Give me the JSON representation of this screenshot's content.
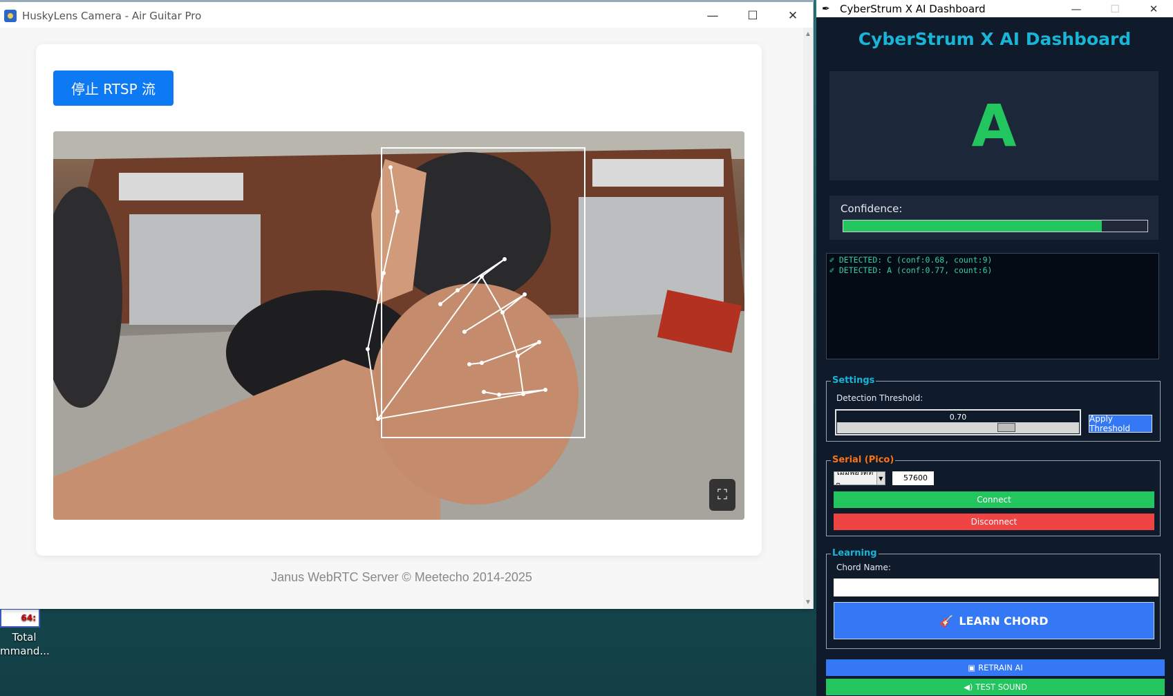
{
  "desktop": {
    "icon_badge": "64:",
    "icon_label_1": "Total",
    "icon_label_2": "mmand..."
  },
  "left_window": {
    "title": "HuskyLens Camera - Air Guitar Pro",
    "controls": {
      "minimize": "—",
      "maximize": "☐",
      "close": "✕"
    },
    "stop_button": "停止 RTSP 流",
    "fullscreen_icon": "⛶",
    "footer": "Janus WebRTC Server © Meetecho 2014-2025"
  },
  "right_window": {
    "title": "CyberStrum X AI Dashboard",
    "controls": {
      "minimize": "—",
      "maximize": "☐",
      "close": "✕"
    },
    "header": "CyberStrum X AI Dashboard",
    "detected_chord": "A",
    "confidence_label": "Confidence:",
    "confidence_value": 0.85,
    "log_lines": [
      "DETECTED: C (conf:0.68, count:9)",
      "DETECTED: A (conf:0.77, count:6)"
    ],
    "settings": {
      "title": "Settings",
      "threshold_label": "Detection Threshold:",
      "threshold_value": "0.70",
      "threshold_fraction": 0.7,
      "apply_button": "Apply Threshold"
    },
    "serial": {
      "title": "Serial (Pico)",
      "port_value": "ไม่มีพอร์ตที่ต",
      "baud_value": "57600",
      "connect_button": "Connect",
      "disconnect_button": "Disconnect"
    },
    "learning": {
      "title": "Learning",
      "chord_name_label": "Chord Name:",
      "chord_name_value": "",
      "learn_button": "LEARN CHORD"
    },
    "retrain_button": "RETRAIN AI",
    "test_sound_button": "TEST SOUND"
  },
  "colors": {
    "stop_button": "#0d79f2",
    "dashboard_title": "#19b5d6",
    "chord": "#22c55e",
    "connect": "#22c55e",
    "disconnect": "#ef4444",
    "learn": "#3478f6",
    "settings_title": "#19b5d6",
    "serial_title": "#f97316"
  },
  "icons": {
    "log_line": "pencil-check-icon",
    "learn": "guitar-icon",
    "retrain": "disk-icon",
    "test_sound": "speaker-icon"
  }
}
